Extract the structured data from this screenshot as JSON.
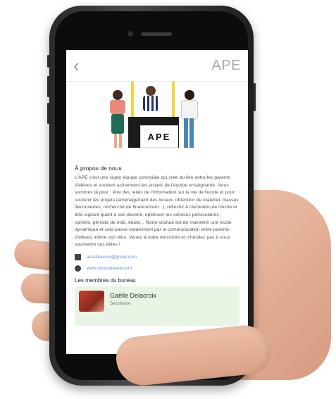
{
  "header": {
    "back_icon": "chevron-left-icon",
    "title": "APE"
  },
  "illustration": {
    "stand_label": "APE"
  },
  "about": {
    "title": "À propos de nous",
    "text": "L'APE c'est une super équipe conviviale qui crée du lien entre les parents d'élèves et soutient activement les projets de l'équipe enseignante. Nous sommes là pour : être des relais de l'information sur la vie de l'école et pour soutenir les projets (aménagement des locaux, obtention de matériel, classes découvertes, recherché de financement...), réfléchir à l'évolution de l'école et être vigilant quant à son devenir, optimiser les services périscolaires : cantine, période de midi, étude... Notre souhait est de maintenir une école dynamique et cela passe notamment par la communication entre parents d'élèves même non élus. Venez à notre rencontre et n'hésitez pas à nous soumettre vos idées !"
  },
  "contacts": [
    {
      "icon": "mail-icon",
      "text": "assofluence@gmail.com"
    },
    {
      "icon": "globe-icon",
      "text": "www.monsiteweb.com"
    }
  ],
  "members": {
    "title": "Les membres du bureau",
    "items": [
      {
        "name": "Gaëlle Delacroix",
        "role": "Secrétaire"
      }
    ]
  },
  "colors": {
    "link": "#5b8fd6",
    "member_card_bg": "#e8f5e5",
    "pole_yellow": "#f2d53b"
  }
}
